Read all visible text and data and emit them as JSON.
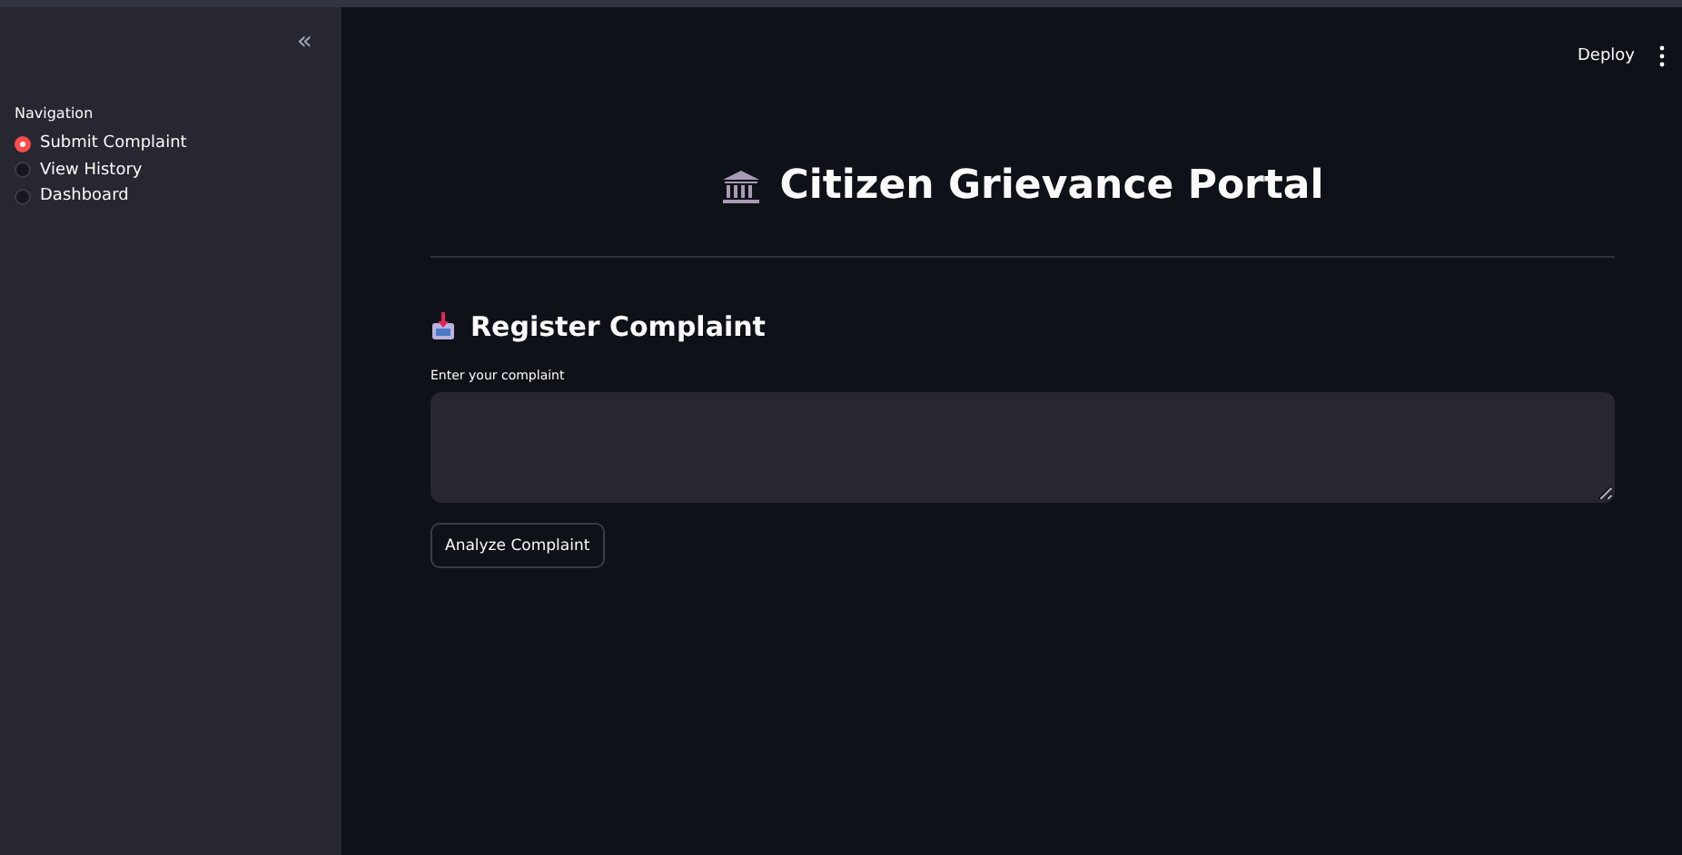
{
  "sidebar": {
    "collapse_icon": "«",
    "navigation": {
      "label": "Navigation",
      "options": [
        {
          "label": "Submit Complaint",
          "selected": true
        },
        {
          "label": "View History",
          "selected": false
        },
        {
          "label": "Dashboard",
          "selected": false
        }
      ]
    }
  },
  "header": {
    "deploy": "Deploy"
  },
  "main": {
    "title": "Citizen Grievance Portal",
    "section": "Register Complaint",
    "complaint_field": {
      "label": "Enter your complaint"
    },
    "button": "Analyze Complaint"
  }
}
